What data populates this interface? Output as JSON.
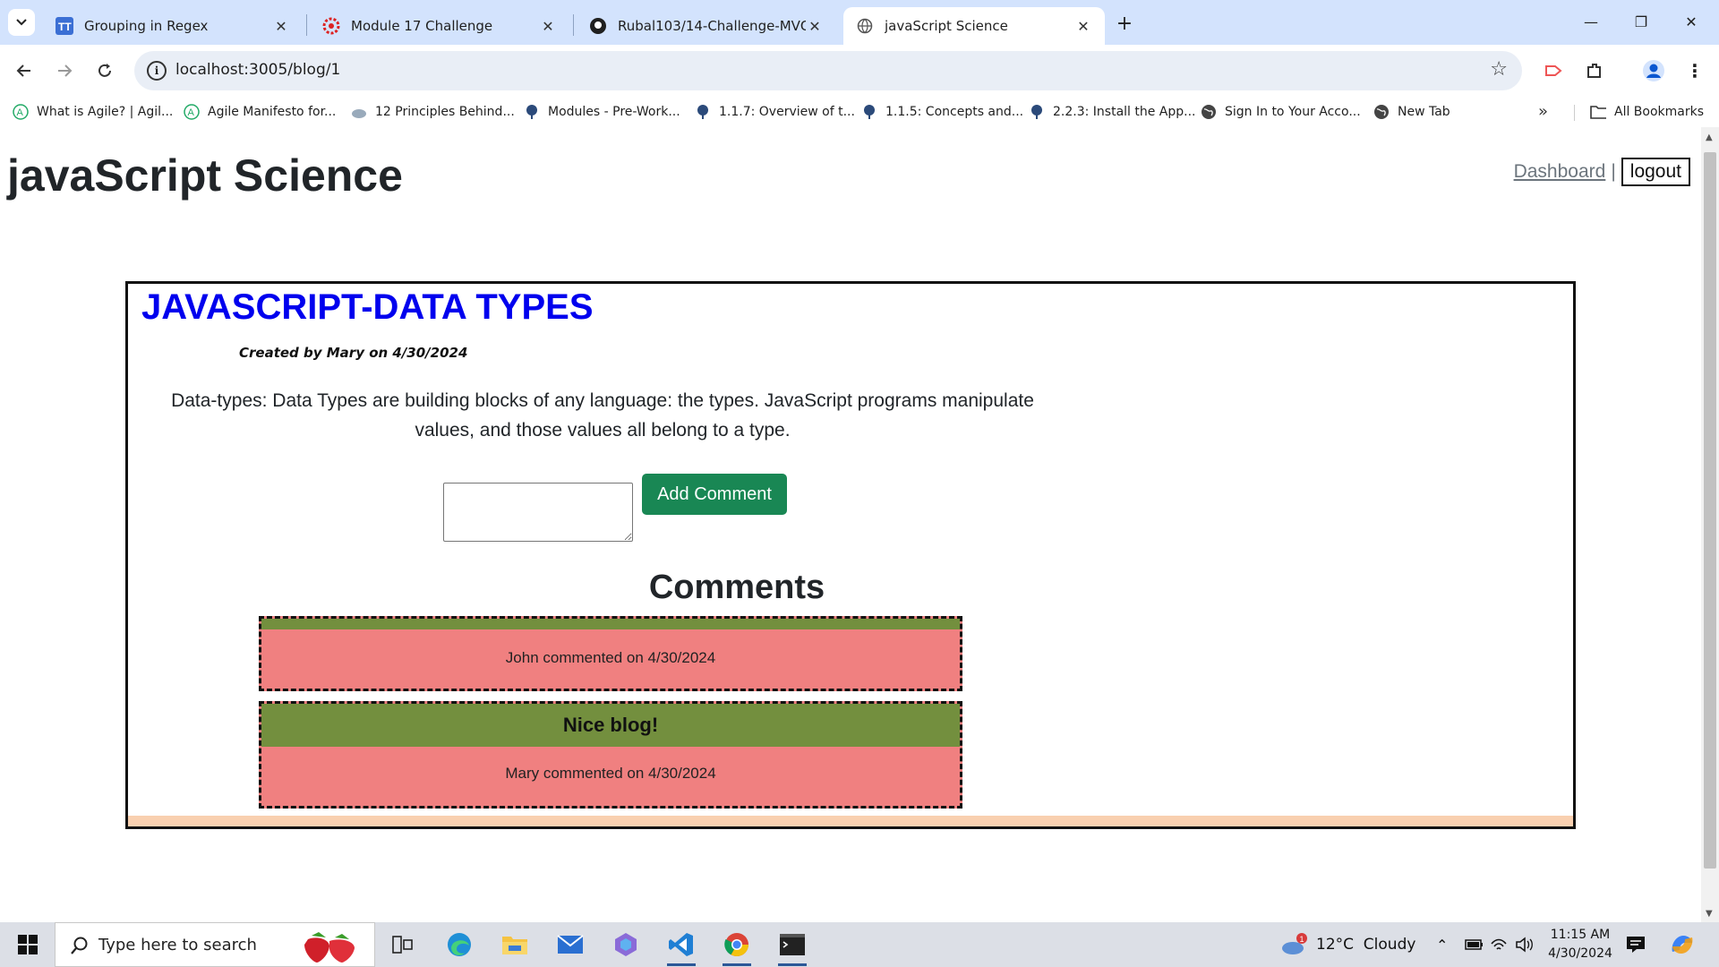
{
  "browser": {
    "tabs": [
      {
        "title": "Grouping in Regex",
        "favicon": "tt-icon",
        "active": false
      },
      {
        "title": "Module 17 Challenge",
        "favicon": "gear-red-icon",
        "active": false
      },
      {
        "title": "Rubal103/14-Challenge-MVC-T",
        "favicon": "github-icon",
        "active": false
      },
      {
        "title": "javaScript Science",
        "favicon": "globe-icon",
        "active": true
      }
    ],
    "url": "localhost:3005/blog/1",
    "bookmarks": [
      {
        "label": "What is Agile? | Agil...",
        "icon": "agile-icon"
      },
      {
        "label": "Agile Manifesto for...",
        "icon": "agile-icon"
      },
      {
        "label": "12 Principles Behind...",
        "icon": "cloud-icon"
      },
      {
        "label": "Modules - Pre-Work...",
        "icon": "tree-icon"
      },
      {
        "label": "1.1.7: Overview of t...",
        "icon": "tree-icon"
      },
      {
        "label": "1.1.5: Concepts and...",
        "icon": "tree-icon"
      },
      {
        "label": "2.2.3: Install the App...",
        "icon": "tree-icon"
      },
      {
        "label": "Sign In to Your Acco...",
        "icon": "globe-icon"
      },
      {
        "label": "New Tab",
        "icon": "globe-icon"
      }
    ],
    "all_bookmarks": "All Bookmarks"
  },
  "page": {
    "site_title": "javaScript Science",
    "nav": {
      "dashboard": "Dashboard",
      "separator": "|",
      "logout": "logout"
    },
    "post": {
      "title": "JAVASCRIPT-DATA TYPES",
      "meta": "Created by Mary on 4/30/2024",
      "body": "Data-types: Data Types are building blocks of any language: the types. JavaScript programs manipulate values, and those values all belong to a type."
    },
    "comment_form": {
      "textarea_value": "",
      "button": "Add Comment"
    },
    "comments_heading": "Comments",
    "comments": [
      {
        "text": "",
        "meta": "John commented on 4/30/2024"
      },
      {
        "text": "Nice blog!",
        "meta": "Mary commented on 4/30/2024"
      }
    ]
  },
  "taskbar": {
    "search_placeholder": "Type here to search",
    "weather_badge": "1",
    "weather": "12°C  Cloudy",
    "time": "11:15 AM",
    "date": "4/30/2024"
  },
  "colors": {
    "post_title": "#0000ee",
    "add_comment_button": "#198754",
    "comment_header": "#738f3e",
    "comment_body": "#f08080",
    "card_bottom_band": "#f9d0b0"
  }
}
